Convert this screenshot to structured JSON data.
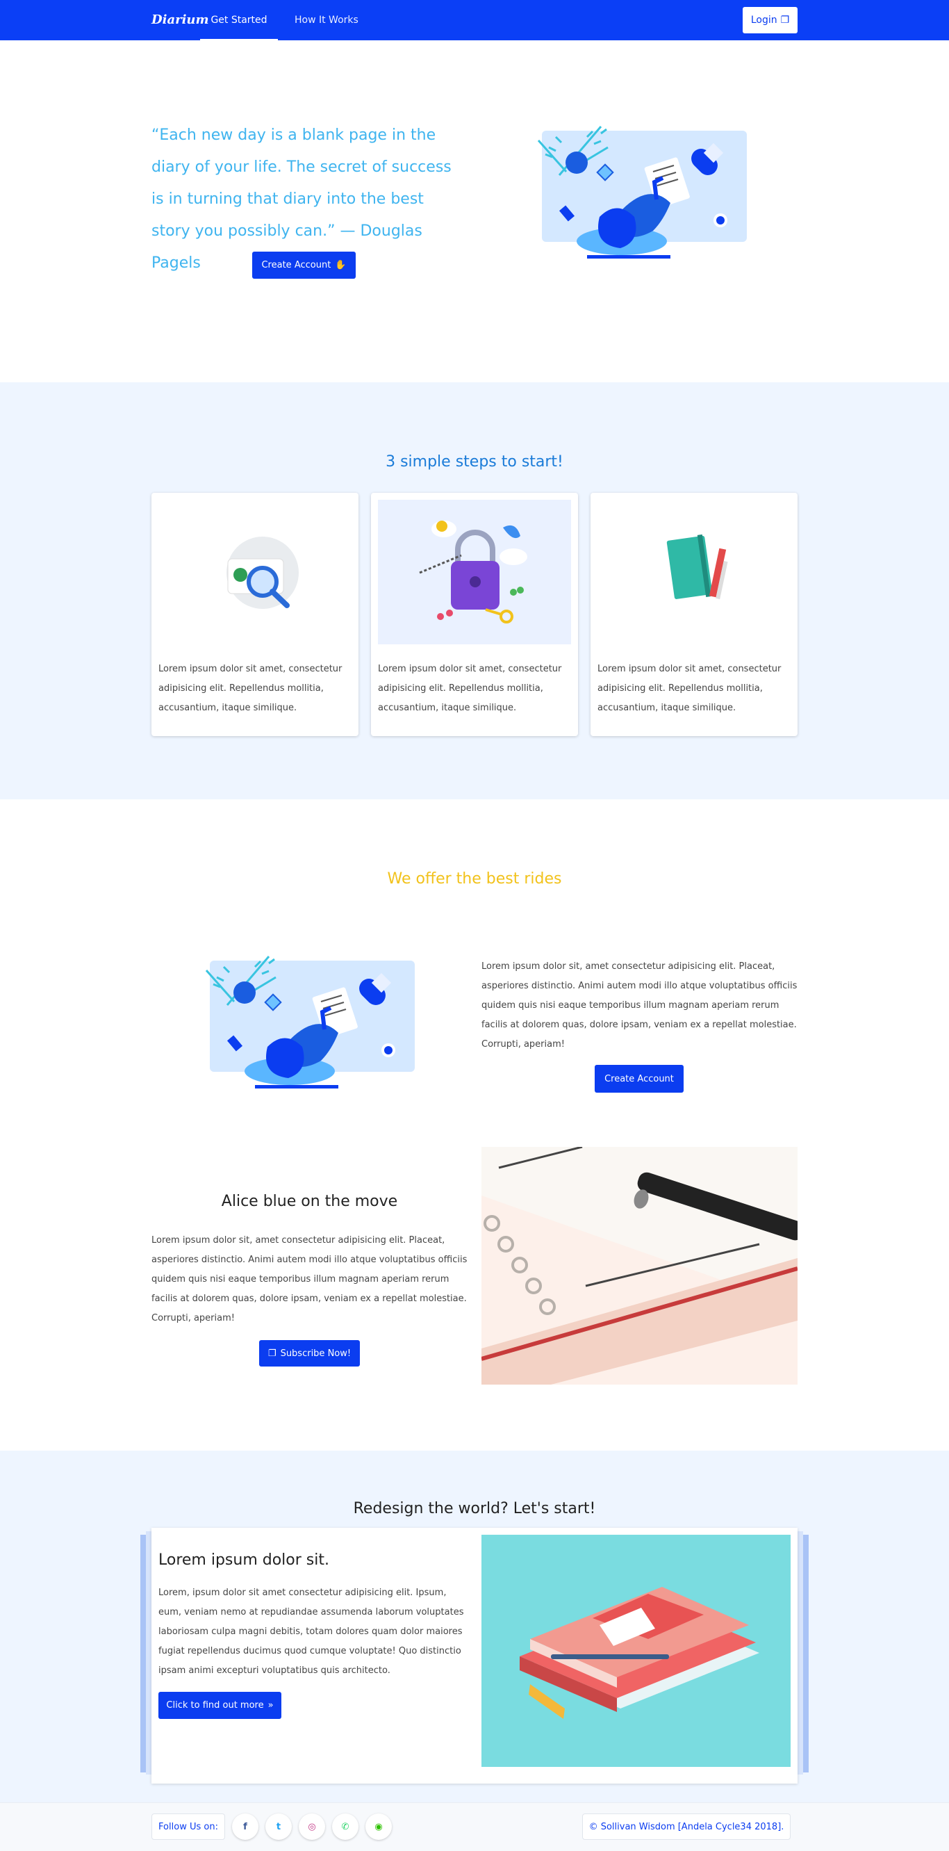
{
  "nav": {
    "brand": "Diarium",
    "links": [
      "Get Started",
      "How It Works"
    ],
    "login_label": "Login"
  },
  "hero": {
    "quote": "“Each new day is a blank page in the diary of your life. The secret of success is in turning that diary into the best story you possibly can.” — Douglas Pagels",
    "cta_label": "Create Account"
  },
  "steps": {
    "title": "3 simple steps to start!",
    "cards": [
      {
        "text": "Lorem ipsum dolor sit amet, consectetur adipisicing elit. Repellendus mollitia, accusantium, itaque similique."
      },
      {
        "text": "Lorem ipsum dolor sit amet, consectetur adipisicing elit. Repellendus mollitia, accusantium, itaque similique."
      },
      {
        "text": "Lorem ipsum dolor sit amet, consectetur adipisicing elit. Repellendus mollitia, accusantium, itaque similique."
      }
    ]
  },
  "offer": {
    "title": "We offer the best rides",
    "text": "Lorem ipsum dolor sit, amet consectetur adipisicing elit. Placeat, asperiores distinctio. Animi autem modi illo atque voluptatibus officiis quidem quis nisi eaque temporibus illum magnam aperiam rerum facilis at dolorem quas, dolore ipsam, veniam ex a repellat molestiae. Corrupti, aperiam!",
    "cta_label": "Create Account"
  },
  "alice": {
    "title": "Alice blue on the move",
    "text": "Lorem ipsum dolor sit, amet consectetur adipisicing elit. Placeat, asperiores distinctio. Animi autem modi illo atque voluptatibus officiis quidem quis nisi eaque temporibus illum magnam aperiam rerum facilis at dolorem quas, dolore ipsam, veniam ex a repellat molestiae. Corrupti, aperiam!",
    "cta_label": "Subscribe Now!"
  },
  "redesign": {
    "title": "Redesign the world? Let's start!",
    "card_title": "Lorem ipsum dolor sit.",
    "card_text": "Lorem, ipsum dolor sit amet consectetur adipisicing elit. Ipsum, eum, veniam nemo at repudiandae assumenda laborum voluptates laboriosam culpa magni debitis, totam dolores quam dolor maiores fugiat repellendus ducimus quod cumque voluptate! Quo distinctio ipsam animi excepturi voluptatibus quis architecto.",
    "cta_label": "Click to find out more"
  },
  "footer": {
    "follow_label": "Follow Us on:",
    "socials": [
      {
        "icon": "facebook-icon",
        "glyph": "f",
        "color": "#3b5998"
      },
      {
        "icon": "twitter-icon",
        "glyph": "t",
        "color": "#1da1f2"
      },
      {
        "icon": "instagram-icon",
        "glyph": "◎",
        "color": "#c13584"
      },
      {
        "icon": "whatsapp-icon",
        "glyph": "✆",
        "color": "#25d366"
      },
      {
        "icon": "wechat-icon",
        "glyph": "◉",
        "color": "#2dc100"
      }
    ],
    "copyright": "© Sollivan Wisdom [Andela Cycle34 2018]."
  },
  "colors": {
    "primary": "#0b3df0",
    "quote_blue": "#3fb4ef",
    "band_bg": "#eef5ff",
    "heading_yellow": "#f2c21b"
  }
}
